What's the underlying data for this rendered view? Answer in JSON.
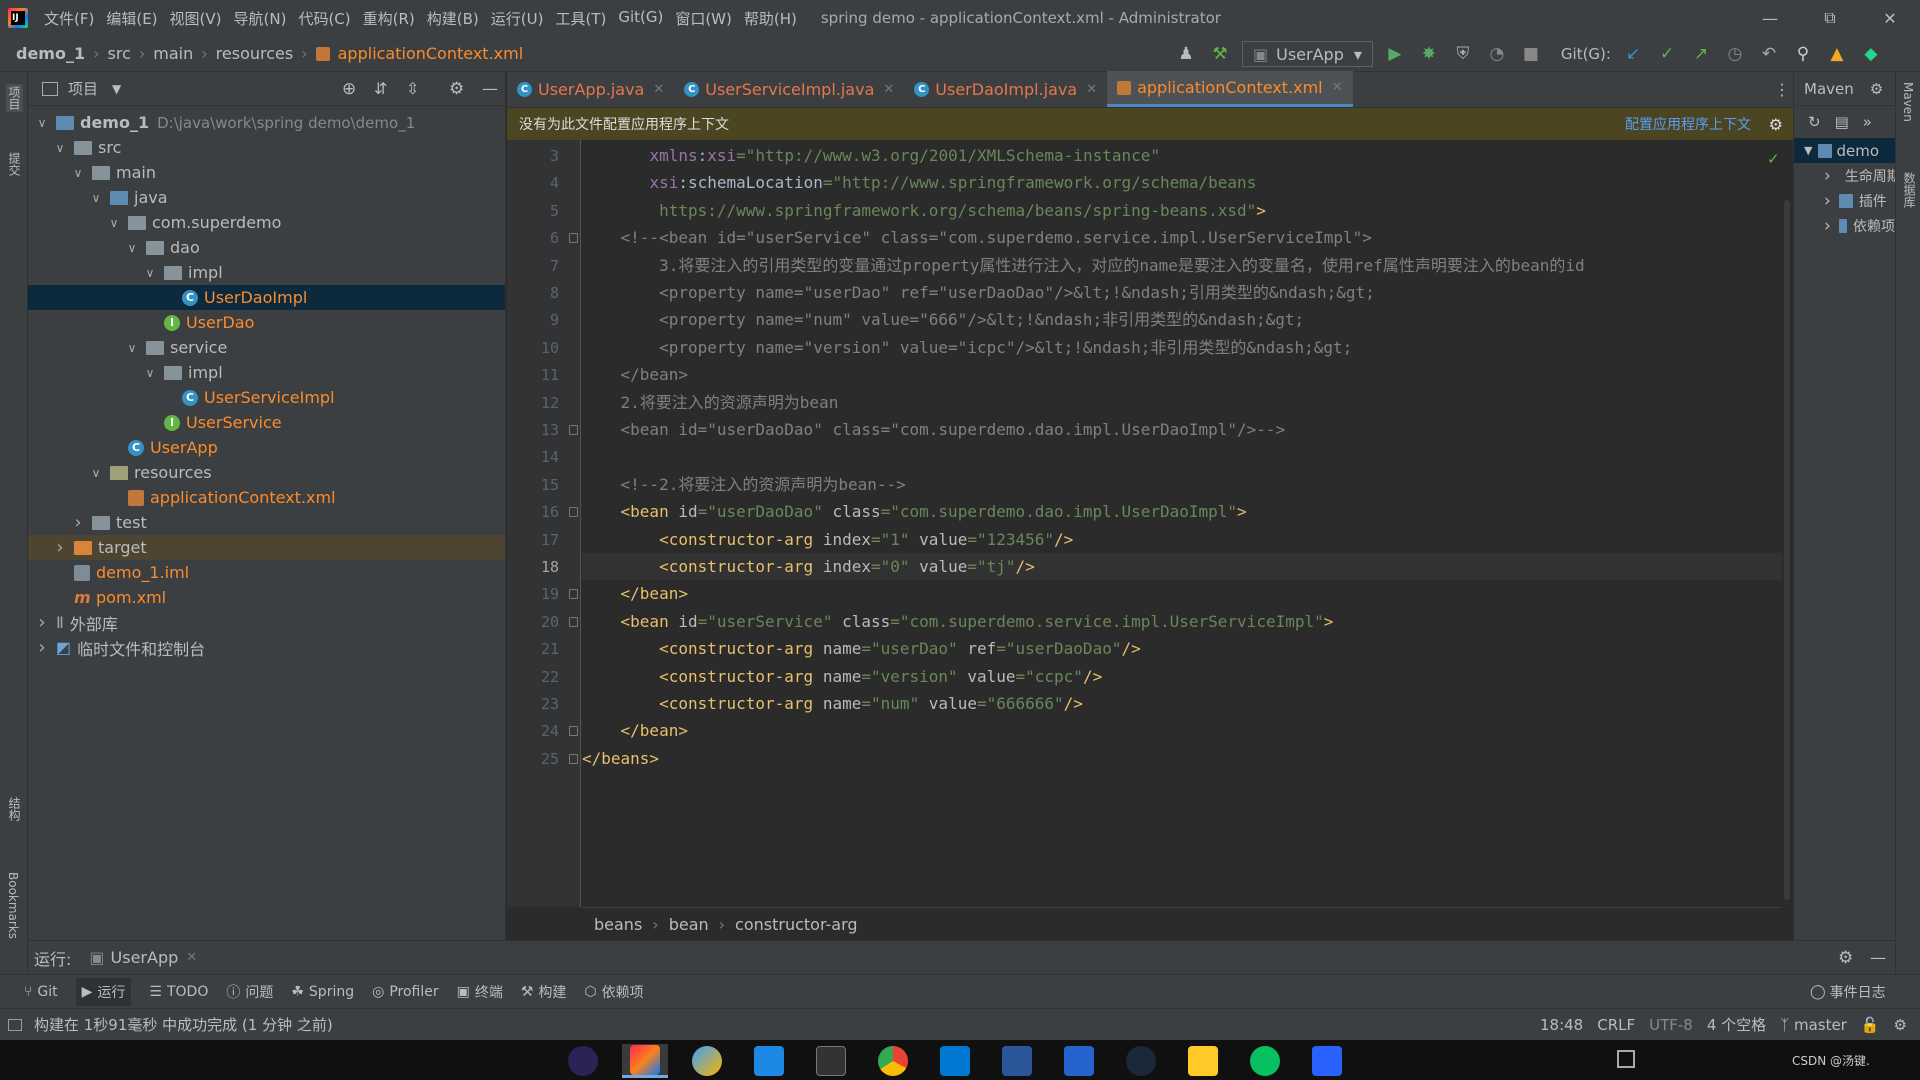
{
  "menu": {
    "items": [
      "文件(F)",
      "编辑(E)",
      "视图(V)",
      "导航(N)",
      "代码(C)",
      "重构(R)",
      "构建(B)",
      "运行(U)",
      "工具(T)",
      "Git(G)",
      "窗口(W)",
      "帮助(H)"
    ],
    "title": "spring demo - applicationContext.xml - Administrator"
  },
  "nav": {
    "crumbs": [
      "demo_1",
      "src",
      "main",
      "resources"
    ],
    "file": "applicationContext.xml",
    "run_config": "UserApp",
    "git_label": "Git(G):"
  },
  "left_strip": {
    "project": "项目",
    "commit": "提交",
    "structure": "结构",
    "bookmarks": "Bookmarks"
  },
  "project": {
    "header": "项目",
    "tree": [
      {
        "label": "demo_1",
        "extra": "D:\\java\\work\\spring demo\\demo_1",
        "icon": "module-folder-icon",
        "depth": 0,
        "arrow": "down",
        "bold": true
      },
      {
        "label": "src",
        "icon": "folder-icon",
        "depth": 1,
        "arrow": "down"
      },
      {
        "label": "main",
        "icon": "folder-icon",
        "depth": 2,
        "arrow": "down"
      },
      {
        "label": "java",
        "icon": "source-folder-icon",
        "depth": 3,
        "arrow": "down"
      },
      {
        "label": "com.superdemo",
        "icon": "package-icon",
        "depth": 4,
        "arrow": "down"
      },
      {
        "label": "dao",
        "icon": "package-icon",
        "depth": 5,
        "arrow": "down"
      },
      {
        "label": "impl",
        "icon": "package-icon",
        "depth": 6,
        "arrow": "down"
      },
      {
        "label": "UserDaoImpl",
        "icon": "class-icon",
        "depth": 7,
        "arrow": "none",
        "color": "orange",
        "selected": true
      },
      {
        "label": "UserDao",
        "icon": "interface-icon",
        "depth": 6,
        "arrow": "none",
        "color": "orange"
      },
      {
        "label": "service",
        "icon": "package-icon",
        "depth": 5,
        "arrow": "down"
      },
      {
        "label": "impl",
        "icon": "package-icon",
        "depth": 6,
        "arrow": "down"
      },
      {
        "label": "UserServiceImpl",
        "icon": "class-icon",
        "depth": 7,
        "arrow": "none",
        "color": "orange"
      },
      {
        "label": "UserService",
        "icon": "interface-icon",
        "depth": 6,
        "arrow": "none",
        "color": "orange"
      },
      {
        "label": "UserApp",
        "icon": "class-main-icon",
        "depth": 4,
        "arrow": "none",
        "color": "orange"
      },
      {
        "label": "resources",
        "icon": "resources-folder-icon",
        "depth": 3,
        "arrow": "down"
      },
      {
        "label": "applicationContext.xml",
        "icon": "xml-file-icon",
        "depth": 4,
        "arrow": "none",
        "color": "orange"
      },
      {
        "label": "test",
        "icon": "folder-icon",
        "depth": 2,
        "arrow": "right"
      },
      {
        "label": "target",
        "icon": "excluded-folder-icon",
        "depth": 1,
        "arrow": "right",
        "target": true
      },
      {
        "label": "demo_1.iml",
        "icon": "iml-file-icon",
        "depth": 1,
        "arrow": "none",
        "color": "orange"
      },
      {
        "label": "pom.xml",
        "icon": "maven-file-icon",
        "depth": 1,
        "arrow": "none",
        "color": "orange"
      },
      {
        "label": "外部库",
        "icon": "library-icon",
        "depth": 0,
        "arrow": "right"
      },
      {
        "label": "临时文件和控制台",
        "icon": "scratch-icon",
        "depth": 0,
        "arrow": "right"
      }
    ]
  },
  "tabs": [
    {
      "label": "UserApp.java",
      "active": false
    },
    {
      "label": "UserServiceImpl.java",
      "active": false
    },
    {
      "label": "UserDaoImpl.java",
      "active": false
    },
    {
      "label": "applicationContext.xml",
      "active": true
    }
  ],
  "notice": {
    "text": "没有为此文件配置应用程序上下文",
    "link": "配置应用程序上下文"
  },
  "editor": {
    "current_line": 18,
    "lines": [
      {
        "n": "3",
        "parts": [
          [
            "pl",
            "       "
          ],
          [
            "ns",
            "xmlns"
          ],
          [
            "pl",
            ":"
          ],
          [
            "ns",
            "xsi"
          ],
          [
            "av",
            "=\"http://www.w3.org/2001/XMLSchema-instance\""
          ]
        ]
      },
      {
        "n": "4",
        "parts": [
          [
            "pl",
            "       "
          ],
          [
            "ns",
            "xsi"
          ],
          [
            "pl",
            ":schemaLocation"
          ],
          [
            "av",
            "=\"http://www.springframework.org/schema/beans"
          ]
        ]
      },
      {
        "n": "5",
        "parts": [
          [
            "av",
            "        https://www.springframework.org/schema/beans/spring-beans.xsd\""
          ],
          [
            "tag",
            ">"
          ]
        ]
      },
      {
        "n": "6",
        "parts": [
          [
            "cm",
            "    <!--<bean id=\"userService\" class=\"com.superdemo.service.impl.UserServiceImpl\">"
          ]
        ]
      },
      {
        "n": "7",
        "parts": [
          [
            "cm",
            "        3.将要注入的引用类型的变量通过property属性进行注入，对应的name是要注入的变量名，使用ref属性声明要注入的bean的id"
          ]
        ]
      },
      {
        "n": "8",
        "parts": [
          [
            "cm",
            "        <property name=\"userDao\" ref=\"userDaoDao\"/>&lt;!&ndash;引用类型的&ndash;&gt;"
          ]
        ]
      },
      {
        "n": "9",
        "parts": [
          [
            "cm",
            "        <property name=\"num\" value=\"666\"/>&lt;!&ndash;非引用类型的&ndash;&gt;"
          ]
        ]
      },
      {
        "n": "10",
        "parts": [
          [
            "cm",
            "        <property name=\"version\" value=\"icpc\"/>&lt;!&ndash;非引用类型的&ndash;&gt;"
          ]
        ]
      },
      {
        "n": "11",
        "parts": [
          [
            "cm",
            "    </bean>"
          ]
        ]
      },
      {
        "n": "12",
        "parts": [
          [
            "cm",
            "    2.将要注入的资源声明为bean"
          ]
        ]
      },
      {
        "n": "13",
        "parts": [
          [
            "cm",
            "    <bean id=\"userDaoDao\" class=\"com.superdemo.dao.impl.UserDaoImpl\"/>-->"
          ]
        ]
      },
      {
        "n": "14",
        "parts": []
      },
      {
        "n": "15",
        "parts": [
          [
            "cm",
            "    <!--2.将要注入的资源声明为bean-->"
          ]
        ]
      },
      {
        "n": "16",
        "parts": [
          [
            "tag",
            "    <bean "
          ],
          [
            "an",
            "id"
          ],
          [
            "av",
            "=\"userDaoDao\" "
          ],
          [
            "an",
            "class"
          ],
          [
            "av",
            "=\"com.superdemo.dao.impl.UserDaoImpl\""
          ],
          [
            "tag",
            ">"
          ]
        ]
      },
      {
        "n": "17",
        "parts": [
          [
            "tag",
            "        <constructor-arg "
          ],
          [
            "an",
            "index"
          ],
          [
            "av",
            "=\"1\" "
          ],
          [
            "an",
            "value"
          ],
          [
            "av",
            "=\"123456\""
          ],
          [
            "tag",
            "/>"
          ]
        ]
      },
      {
        "n": "18",
        "parts": [
          [
            "tag",
            "        <constructor-arg "
          ],
          [
            "an",
            "index"
          ],
          [
            "av",
            "=\"0\" "
          ],
          [
            "an",
            "value"
          ],
          [
            "av",
            "=\"tj\""
          ],
          [
            "tag",
            "/>"
          ]
        ]
      },
      {
        "n": "19",
        "parts": [
          [
            "tag",
            "    </bean>"
          ]
        ]
      },
      {
        "n": "20",
        "parts": [
          [
            "tag",
            "    <bean "
          ],
          [
            "an",
            "id"
          ],
          [
            "av",
            "=\"userService\" "
          ],
          [
            "an",
            "class"
          ],
          [
            "av",
            "=\"com.superdemo.service.impl.UserServiceImpl\""
          ],
          [
            "tag",
            ">"
          ]
        ]
      },
      {
        "n": "21",
        "parts": [
          [
            "tag",
            "        <constructor-arg "
          ],
          [
            "an",
            "name"
          ],
          [
            "av",
            "=\"userDao\" "
          ],
          [
            "an",
            "ref"
          ],
          [
            "av",
            "=\"userDaoDao\""
          ],
          [
            "tag",
            "/>"
          ]
        ]
      },
      {
        "n": "22",
        "parts": [
          [
            "tag",
            "        <constructor-arg "
          ],
          [
            "an",
            "name"
          ],
          [
            "av",
            "=\"version\" "
          ],
          [
            "an",
            "value"
          ],
          [
            "av",
            "=\"ccpc\""
          ],
          [
            "tag",
            "/>"
          ]
        ]
      },
      {
        "n": "23",
        "parts": [
          [
            "tag",
            "        <constructor-arg "
          ],
          [
            "an",
            "name"
          ],
          [
            "av",
            "=\"num\" "
          ],
          [
            "an",
            "value"
          ],
          [
            "av",
            "=\"666666\""
          ],
          [
            "tag",
            "/>"
          ]
        ]
      },
      {
        "n": "24",
        "parts": [
          [
            "tag",
            "    </bean>"
          ]
        ]
      },
      {
        "n": "25",
        "parts": [
          [
            "tag",
            "</beans>"
          ]
        ]
      }
    ],
    "breadcrumbs": [
      "beans",
      "bean",
      "constructor-arg"
    ]
  },
  "maven": {
    "title": "Maven",
    "root": "demo",
    "items": [
      "生命周期",
      "插件",
      "依赖项"
    ]
  },
  "right_strip": {
    "maven": "Maven",
    "db": "数据库"
  },
  "run": {
    "label": "运行:",
    "config": "UserApp"
  },
  "toolwindows": [
    "Git",
    "运行",
    "TODO",
    "问题",
    "Spring",
    "Profiler",
    "终端",
    "构建",
    "依赖项"
  ],
  "event_log": "事件日志",
  "status": {
    "message": "构建在 1秒91毫秒 中成功完成 (1 分钟 之前)",
    "position": "18:48",
    "line_sep": "CRLF",
    "encoding": "UTF-8",
    "indent": "4 个空格",
    "branch": "master"
  },
  "taskbar": {
    "user": "CSDN @汤键.",
    "apps": [
      "eclipse",
      "intellij-idea",
      "browser",
      "virtual-machine",
      "terminal",
      "chrome",
      "vscode",
      "word",
      "todo",
      "steam",
      "file-explorer",
      "wechat",
      "video-player"
    ]
  },
  "colors": {
    "accent": "#4a88c7",
    "orange": "#fc8b2c",
    "selection": "#0d293e",
    "notice_bg": "#4b4621"
  }
}
